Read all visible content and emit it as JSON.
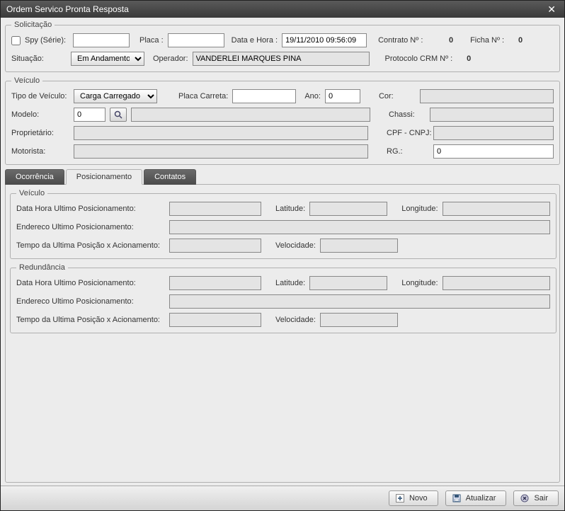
{
  "window": {
    "title": "Ordem Servico Pronta Resposta"
  },
  "solicitacao": {
    "legend": "Solicitação",
    "spy_label": "Spy (Série):",
    "spy_value": "",
    "placa_label": "Placa :",
    "placa_value": "",
    "datahora_label": "Data e Hora :",
    "datahora_value": "19/11/2010 09:56:09",
    "contrato_label": "Contrato Nº :",
    "contrato_value": "0",
    "ficha_label": "Ficha Nº :",
    "ficha_value": "0",
    "situacao_label": "Situação:",
    "situacao_value": "Em Andamento",
    "operador_label": "Operador:",
    "operador_value": "VANDERLEI MARQUES PINA",
    "protocolo_label": "Protocolo CRM Nº :",
    "protocolo_value": "0"
  },
  "veiculo": {
    "legend": "Veículo",
    "tipo_label": "Tipo de Veículo:",
    "tipo_value": "Carga Carregado",
    "placa_carreta_label": "Placa Carreta:",
    "placa_carreta_value": "",
    "ano_label": "Ano:",
    "ano_value": "0",
    "cor_label": "Cor:",
    "cor_value": "",
    "modelo_label": "Modelo:",
    "modelo_value": "0",
    "modelo_desc": "",
    "chassi_label": "Chassi:",
    "chassi_value": "",
    "proprietario_label": "Proprietário:",
    "proprietario_value": "",
    "cpfcnpj_label": "CPF - CNPJ:",
    "cpfcnpj_value": "",
    "motorista_label": "Motorista:",
    "motorista_value": "",
    "rg_label": "RG.:",
    "rg_value": "0"
  },
  "tabs": {
    "ocorrencia": "Ocorrência",
    "posicionamento": "Posicionamento",
    "contatos": "Contatos"
  },
  "posicionamento": {
    "veiculo_legend": "Veículo",
    "redundancia_legend": "Redundância",
    "datahora_label": "Data Hora Ultimo Posicionamento:",
    "latitude_label": "Latitude:",
    "longitude_label": "Longitude:",
    "endereco_label": "Endereco Ultimo Posicionamento:",
    "tempo_label": "Tempo da Ultima Posição x Acionamento:",
    "velocidade_label": "Velocidade:",
    "v_datahora": "",
    "v_lat": "",
    "v_lon": "",
    "v_end": "",
    "v_tempo": "",
    "v_vel": "",
    "r_datahora": "",
    "r_lat": "",
    "r_lon": "",
    "r_end": "",
    "r_tempo": "",
    "r_vel": ""
  },
  "footer": {
    "novo": "Novo",
    "atualizar": "Atualizar",
    "sair": "Sair"
  }
}
